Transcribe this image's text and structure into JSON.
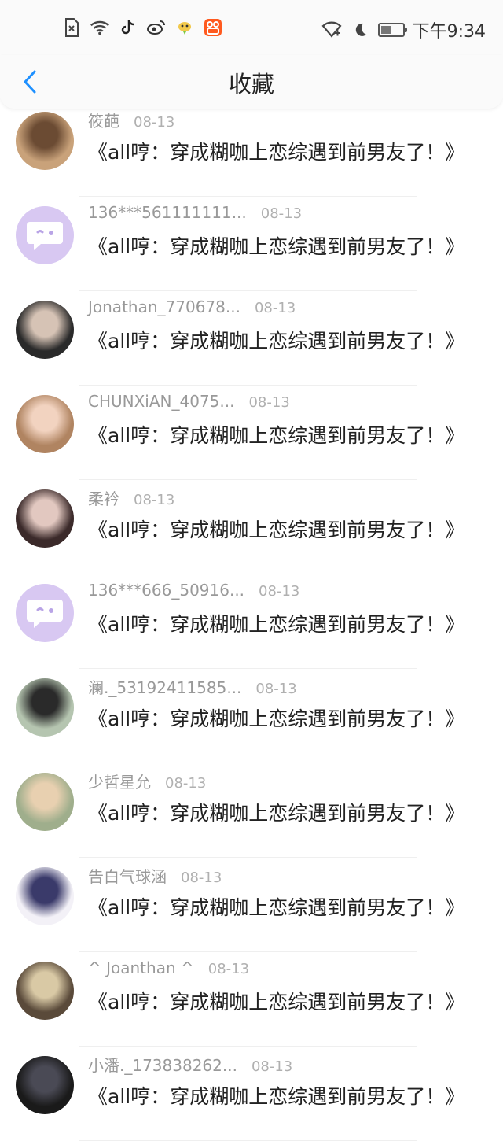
{
  "status": {
    "time": "下午9:34"
  },
  "header": {
    "title": "收藏"
  },
  "items": [
    {
      "name": "筱葩",
      "date": "08-13",
      "message": "《all哼：穿成糊咖上恋综遇到前男友了！》",
      "avatar": "photo",
      "avatar_colors": [
        "#c9a27a",
        "#6b4b33"
      ]
    },
    {
      "name": "136***561111111...",
      "date": "08-13",
      "message": "《all哼：穿成糊咖上恋综遇到前男友了！》",
      "avatar": "bot",
      "avatar_colors": [
        "#d8c8f2",
        "#ffffff"
      ]
    },
    {
      "name": "Jonathan_770678...",
      "date": "08-13",
      "message": "《all哼：穿成糊咖上恋综遇到前男友了！》",
      "avatar": "photo",
      "avatar_colors": [
        "#2a2a2a",
        "#d6c3b5"
      ]
    },
    {
      "name": "CHUNXiAN_4075...",
      "date": "08-13",
      "message": "《all哼：穿成糊咖上恋综遇到前男友了！》",
      "avatar": "photo",
      "avatar_colors": [
        "#b08461",
        "#f2d3c0"
      ]
    },
    {
      "name": "柔衿",
      "date": "08-13",
      "message": "《all哼：穿成糊咖上恋综遇到前男友了！》",
      "avatar": "photo",
      "avatar_colors": [
        "#3b2a2a",
        "#e2c8c0"
      ]
    },
    {
      "name": "136***666_50916...",
      "date": "08-13",
      "message": "《all哼：穿成糊咖上恋综遇到前男友了！》",
      "avatar": "bot",
      "avatar_colors": [
        "#d8c8f2",
        "#ffffff"
      ]
    },
    {
      "name": "澜._53192411585...",
      "date": "08-13",
      "message": "《all哼：穿成糊咖上恋综遇到前男友了！》",
      "avatar": "photo",
      "avatar_colors": [
        "#b5c5b0",
        "#2a2a2a"
      ]
    },
    {
      "name": "少哲星允",
      "date": "08-13",
      "message": "《all哼：穿成糊咖上恋综遇到前男友了！》",
      "avatar": "photo",
      "avatar_colors": [
        "#9fae8c",
        "#e8d0b0"
      ]
    },
    {
      "name": "告白气球涵",
      "date": "08-13",
      "message": "《all哼：穿成糊咖上恋综遇到前男友了！》",
      "avatar": "photo",
      "avatar_colors": [
        "#f3f1f7",
        "#3a3a6a"
      ]
    },
    {
      "name": "^ Joanthan ^",
      "date": "08-13",
      "message": "《all哼：穿成糊咖上恋综遇到前男友了！》",
      "avatar": "photo",
      "avatar_colors": [
        "#5a4a3a",
        "#d9c9a5"
      ]
    },
    {
      "name": "小潘._173838262...",
      "date": "08-13",
      "message": "《all哼：穿成糊咖上恋综遇到前男友了！》",
      "avatar": "photo",
      "avatar_colors": [
        "#1a1a1a",
        "#4a4a55"
      ]
    }
  ]
}
